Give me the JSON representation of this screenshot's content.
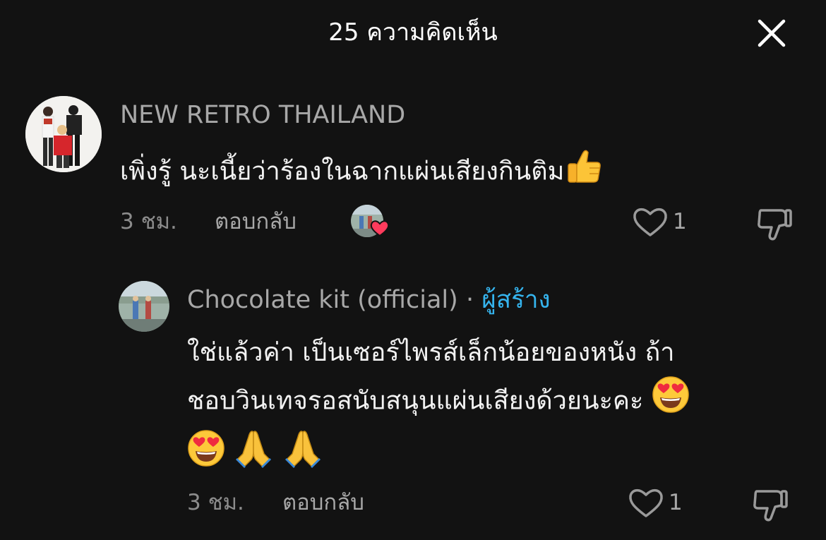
{
  "header": {
    "title": "25 ความคิดเห็น"
  },
  "comments": [
    {
      "username": "NEW RETRO THAILAND",
      "text": "เพิ่งรู้ นะเนี้ยว่าร้องในฉากแผ่นเสียงกินติม",
      "emoji_after": [
        "thumbs-up"
      ],
      "time": "3 ชม.",
      "reply_label": "ตอบกลับ",
      "creator_liked": true,
      "like_count": "1"
    }
  ],
  "replies": [
    {
      "username": "Chocolate kit (official)",
      "separator": "·",
      "badge": "ผู้สร้าง",
      "text_line1": "ใช่แล้วค่า เป็นเซอร์ไพรส์เล็กน้อยของหนัง ถ้า",
      "text_line2": "ชอบวินเทจรอสนับสนุนแผ่นเสียงด้วยนะคะ",
      "emoji_after": [
        "heart-eyes",
        "heart-eyes",
        "folded-hands",
        "folded-hands"
      ],
      "time": "3 ชม.",
      "reply_label": "ตอบกลับ",
      "like_count": "1"
    }
  ],
  "colors": {
    "background": "#121212",
    "username": "#a8a8a8",
    "creator_badge": "#35b4ee",
    "like_heart": "#ff3b5c"
  }
}
